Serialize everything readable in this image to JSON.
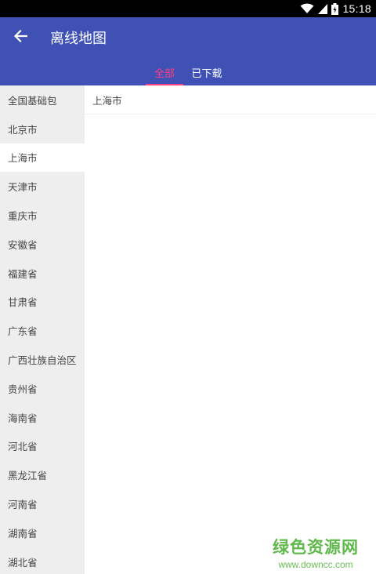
{
  "status_bar": {
    "time": "15:18",
    "icons": [
      "wifi-icon",
      "cell-signal-icon",
      "battery-icon"
    ]
  },
  "app_bar": {
    "title": "离线地图",
    "back_icon": "arrow-left-icon",
    "background": "#3f51b5"
  },
  "tabs": [
    {
      "label": "全部",
      "selected": true
    },
    {
      "label": "已下载",
      "selected": false
    }
  ],
  "accent_color": "#ff4081",
  "sidebar": {
    "selected": "上海市",
    "items": [
      "全国基础包",
      "北京市",
      "上海市",
      "天津市",
      "重庆市",
      "安徽省",
      "福建省",
      "甘肃省",
      "广东省",
      "广西壮族自治区",
      "贵州省",
      "海南省",
      "河北省",
      "黑龙江省",
      "河南省",
      "湖南省",
      "湖北省"
    ]
  },
  "content": {
    "cities": [
      "上海市"
    ]
  },
  "watermark": {
    "title": "绿色资源网",
    "url": "www.downcc.com"
  }
}
